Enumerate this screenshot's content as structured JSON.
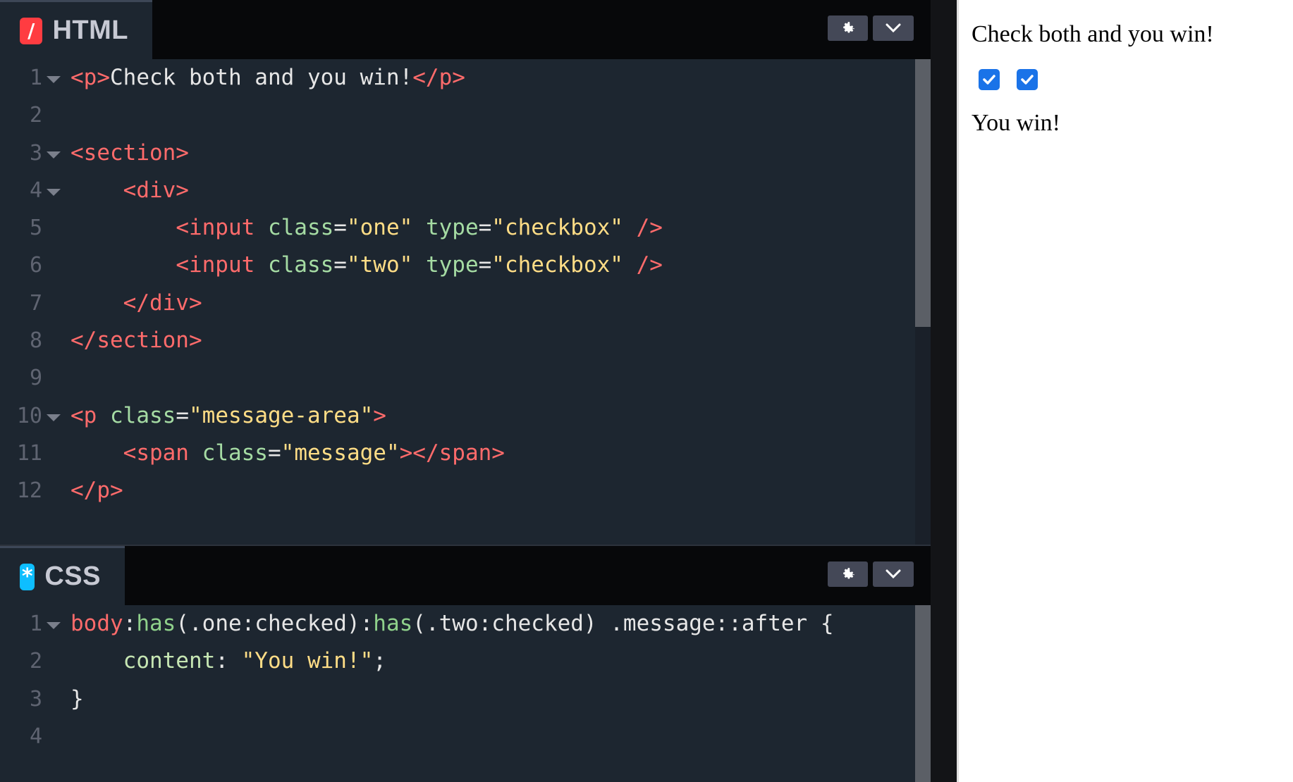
{
  "html_panel": {
    "title": "HTML",
    "icon": "html-slash-icon",
    "icon_glyph": "/",
    "lines": [
      {
        "n": "1",
        "fold": true,
        "tokens": [
          {
            "c": "tag",
            "t": "<p>"
          },
          {
            "c": "text",
            "t": "Check both and you win!"
          },
          {
            "c": "tag",
            "t": "</p>"
          }
        ]
      },
      {
        "n": "2",
        "fold": false,
        "tokens": []
      },
      {
        "n": "3",
        "fold": true,
        "tokens": [
          {
            "c": "tag",
            "t": "<section>"
          }
        ]
      },
      {
        "n": "4",
        "fold": true,
        "tokens": [
          {
            "c": "text",
            "t": "    "
          },
          {
            "c": "tag",
            "t": "<div>"
          }
        ]
      },
      {
        "n": "5",
        "fold": false,
        "tokens": [
          {
            "c": "text",
            "t": "        "
          },
          {
            "c": "tag",
            "t": "<input"
          },
          {
            "c": "text",
            "t": " "
          },
          {
            "c": "attr",
            "t": "class"
          },
          {
            "c": "text",
            "t": "="
          },
          {
            "c": "str",
            "t": "\"one\""
          },
          {
            "c": "text",
            "t": " "
          },
          {
            "c": "attr",
            "t": "type"
          },
          {
            "c": "text",
            "t": "="
          },
          {
            "c": "str",
            "t": "\"checkbox\""
          },
          {
            "c": "text",
            "t": " "
          },
          {
            "c": "tag",
            "t": "/>"
          }
        ]
      },
      {
        "n": "6",
        "fold": false,
        "tokens": [
          {
            "c": "text",
            "t": "        "
          },
          {
            "c": "tag",
            "t": "<input"
          },
          {
            "c": "text",
            "t": " "
          },
          {
            "c": "attr",
            "t": "class"
          },
          {
            "c": "text",
            "t": "="
          },
          {
            "c": "str",
            "t": "\"two\""
          },
          {
            "c": "text",
            "t": " "
          },
          {
            "c": "attr",
            "t": "type"
          },
          {
            "c": "text",
            "t": "="
          },
          {
            "c": "str",
            "t": "\"checkbox\""
          },
          {
            "c": "text",
            "t": " "
          },
          {
            "c": "tag",
            "t": "/>"
          }
        ]
      },
      {
        "n": "7",
        "fold": false,
        "tokens": [
          {
            "c": "text",
            "t": "    "
          },
          {
            "c": "tag",
            "t": "</div>"
          }
        ]
      },
      {
        "n": "8",
        "fold": false,
        "tokens": [
          {
            "c": "tag",
            "t": "</section>"
          }
        ]
      },
      {
        "n": "9",
        "fold": false,
        "tokens": []
      },
      {
        "n": "10",
        "fold": true,
        "tokens": [
          {
            "c": "tag",
            "t": "<p"
          },
          {
            "c": "text",
            "t": " "
          },
          {
            "c": "attr",
            "t": "class"
          },
          {
            "c": "text",
            "t": "="
          },
          {
            "c": "str",
            "t": "\"message-area\""
          },
          {
            "c": "tag",
            "t": ">"
          }
        ]
      },
      {
        "n": "11",
        "fold": false,
        "tokens": [
          {
            "c": "text",
            "t": "    "
          },
          {
            "c": "tag",
            "t": "<span"
          },
          {
            "c": "text",
            "t": " "
          },
          {
            "c": "attr",
            "t": "class"
          },
          {
            "c": "text",
            "t": "="
          },
          {
            "c": "str",
            "t": "\"message\""
          },
          {
            "c": "tag",
            "t": "></span>"
          }
        ]
      },
      {
        "n": "12",
        "fold": false,
        "tokens": [
          {
            "c": "tag",
            "t": "</p>"
          }
        ]
      }
    ]
  },
  "css_panel": {
    "title": "CSS",
    "icon": "css-asterisk-icon",
    "icon_glyph": "*",
    "lines": [
      {
        "n": "1",
        "fold": true,
        "tokens": [
          {
            "c": "sel",
            "t": "body"
          },
          {
            "c": "punc",
            "t": ":"
          },
          {
            "c": "fn",
            "t": "has"
          },
          {
            "c": "punc",
            "t": "(.one:checked):"
          },
          {
            "c": "fn",
            "t": "has"
          },
          {
            "c": "punc",
            "t": "(.two:checked) .message::after {"
          }
        ]
      },
      {
        "n": "2",
        "fold": false,
        "tokens": [
          {
            "c": "text",
            "t": "    "
          },
          {
            "c": "prop",
            "t": "content"
          },
          {
            "c": "punc",
            "t": ": "
          },
          {
            "c": "str",
            "t": "\"You win!\""
          },
          {
            "c": "punc",
            "t": ";"
          }
        ]
      },
      {
        "n": "3",
        "fold": false,
        "tokens": [
          {
            "c": "punc",
            "t": "}"
          }
        ]
      },
      {
        "n": "4",
        "fold": false,
        "tokens": []
      }
    ]
  },
  "preview": {
    "heading": "Check both and you win!",
    "checkbox_one_checked": true,
    "checkbox_two_checked": true,
    "message": "You win!"
  },
  "colors": {
    "editor_bg": "#1d2630",
    "header_bg": "#07080a",
    "html_icon": "#ff3c41",
    "css_icon": "#0ebeff",
    "tag": "#ff6b6b",
    "attr": "#a5dba3",
    "string": "#ffdd86",
    "checkbox": "#1a73e8"
  }
}
